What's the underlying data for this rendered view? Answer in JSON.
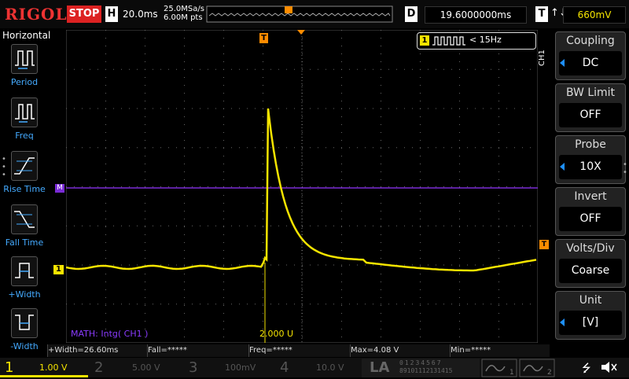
{
  "brand": "RIGOL",
  "run_state": "STOP",
  "timebase": {
    "letter": "H",
    "value": "20.0ms"
  },
  "sample": {
    "rate": "25.0MSa/s",
    "points": "6.00M pts"
  },
  "delay": {
    "letter": "D",
    "value": "19.6000000ms"
  },
  "trigger": {
    "letter": "T",
    "level": "660mV"
  },
  "left_menu": {
    "title": "Horizontal",
    "items": [
      {
        "label": "Period"
      },
      {
        "label": "Freq"
      },
      {
        "label": "Rise Time"
      },
      {
        "label": "Fall Time"
      },
      {
        "label": "+Width"
      },
      {
        "label": "-Width"
      }
    ]
  },
  "freq_badge": {
    "channel": "1",
    "text": "< 15Hz"
  },
  "ch_vertical_label": "CH1",
  "right_menu": [
    {
      "title": "Coupling",
      "value": "DC"
    },
    {
      "title": "BW Limit",
      "value": "OFF"
    },
    {
      "title": "Probe",
      "value": "10X"
    },
    {
      "title": "Invert",
      "value": "OFF"
    },
    {
      "title": "Volts/Div",
      "value": "Coarse"
    },
    {
      "title": "Unit",
      "value": "[V]"
    }
  ],
  "markers": {
    "trigger_top": "T",
    "math": "M",
    "ch1": "1",
    "trigger_right": "T"
  },
  "math_label": "MATH: Intg( CH1 )",
  "math_scale": "2.000 U",
  "measurements": {
    "pwidth": "+Width=26.60ms",
    "fall": "Fall=*****",
    "freq": "Freq=*****",
    "max": "Max=4.08 V",
    "min": "Min=*****"
  },
  "channels": [
    {
      "num": "1",
      "scale": "1.00 V",
      "color": "#f5e400"
    },
    {
      "num": "2",
      "scale": "5.00 V",
      "color": "#00c8ff"
    },
    {
      "num": "3",
      "scale": "100mV",
      "color": "#ff44cc"
    },
    {
      "num": "4",
      "scale": "10.0 V",
      "color": "#2a6cff"
    }
  ],
  "la": {
    "label": "LA",
    "row1": "01234567",
    "row2": "89101112131415"
  },
  "colors": {
    "ch1": "#f5e400",
    "math": "#7a2bd6",
    "accent": "#1e90ff",
    "trigger": "#ff8c00"
  }
}
